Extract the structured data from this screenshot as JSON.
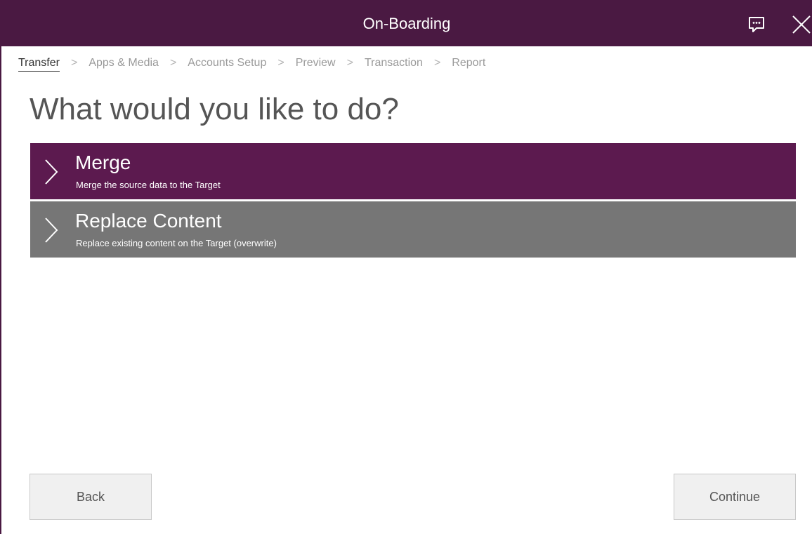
{
  "window": {
    "title": "On-Boarding"
  },
  "titlebar": {
    "feedback_icon": "chat-bubble-icon",
    "close_icon": "close-icon"
  },
  "breadcrumb": {
    "steps": [
      "Transfer",
      "Apps & Media",
      "Accounts Setup",
      "Preview",
      "Transaction",
      "Report"
    ],
    "active_index": 0
  },
  "main": {
    "heading": "What would you like to do?",
    "options": [
      {
        "title": "Merge",
        "description": "Merge the source data to the Target",
        "selected": true
      },
      {
        "title": "Replace Content",
        "description": "Replace existing content on the Target (overwrite)",
        "selected": false
      }
    ]
  },
  "footer": {
    "back_label": "Back",
    "continue_label": "Continue"
  },
  "colors": {
    "accent": "#4a1942",
    "selected_option": "#5c1a4f",
    "unselected_option": "#767676"
  }
}
